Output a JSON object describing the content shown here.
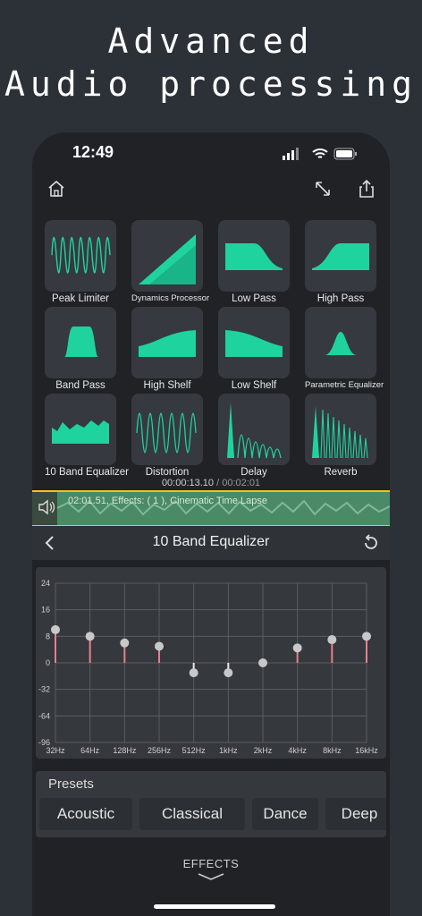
{
  "hero": {
    "line1": "Advanced",
    "line2": "Audio processing"
  },
  "status": {
    "time": "12:49"
  },
  "effects": [
    "Peak Limiter",
    "Dynamics Processor",
    "Low Pass",
    "High Pass",
    "Band Pass",
    "High Shelf",
    "Low Shelf",
    "Parametric Equalizer",
    "10 Band Equalizer",
    "Distortion",
    "Delay",
    "Reverb"
  ],
  "playback": {
    "current": "00:00:13.10",
    "total": "00:02:01"
  },
  "track": {
    "label": "02:01.51, Effects: ( 1 ), Cinematic Time Lapse"
  },
  "panel": {
    "title": "10 Band Equalizer"
  },
  "chart_data": {
    "type": "scatter",
    "title": "",
    "categories": [
      "32Hz",
      "64Hz",
      "128Hz",
      "256Hz",
      "512Hz",
      "1kHz",
      "2kHz",
      "4kHz",
      "8kHz",
      "16kHz"
    ],
    "values": [
      10,
      8,
      6,
      5,
      -3,
      -3,
      0,
      4.5,
      7,
      8
    ],
    "yticks": [
      "24",
      "16",
      "8",
      "0",
      "-32",
      "-64",
      "-96"
    ],
    "ylim": [
      -96,
      24
    ],
    "grid": true,
    "accent": "#e8808e"
  },
  "presets": {
    "title": "Presets",
    "items": [
      "Acoustic",
      "Classical",
      "Dance",
      "Deep"
    ]
  },
  "footer": {
    "effects_label": "EFFECTS"
  },
  "colors": {
    "accent": "#1fd39e",
    "waveform": "#f2c318"
  }
}
